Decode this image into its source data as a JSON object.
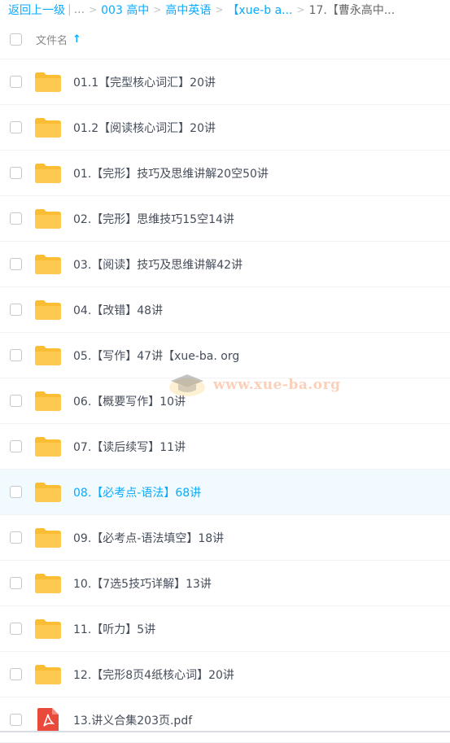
{
  "breadcrumb": {
    "back": "返回上一级",
    "ellipsis": "...",
    "items": [
      "003 高中",
      "高中英语",
      "【xue-b a..."
    ],
    "current": "17.【曹永高中..."
  },
  "header": {
    "column_title": "文件名",
    "sort_icon": "sort-ascending-icon"
  },
  "files": [
    {
      "name": "01.1【完型核心词汇】20讲",
      "type": "folder"
    },
    {
      "name": "01.2【阅读核心词汇】20讲",
      "type": "folder"
    },
    {
      "name": "01.【完形】技巧及思维讲解20空50讲",
      "type": "folder"
    },
    {
      "name": "02.【完形】思维技巧15空14讲",
      "type": "folder"
    },
    {
      "name": "03.【阅读】技巧及思维讲解42讲",
      "type": "folder"
    },
    {
      "name": "04.【改错】48讲",
      "type": "folder"
    },
    {
      "name": "05.【写作】47讲【xue-ba. org",
      "type": "folder"
    },
    {
      "name": "06.【概要写作】10讲",
      "type": "folder"
    },
    {
      "name": "07.【读后续写】11讲",
      "type": "folder"
    },
    {
      "name": "08.【必考点-语法】68讲",
      "type": "folder",
      "selected": true
    },
    {
      "name": "09.【必考点-语法填空】18讲",
      "type": "folder"
    },
    {
      "name": "10.【7选5技巧详解】13讲",
      "type": "folder"
    },
    {
      "name": "11.【听力】5讲",
      "type": "folder"
    },
    {
      "name": "12.【完形8页4纸核心词】20讲",
      "type": "folder"
    },
    {
      "name": "13.讲义合集203页.pdf",
      "type": "pdf"
    }
  ],
  "watermark": {
    "text": "www.xue-ba.org"
  },
  "colors": {
    "accent": "#09aaff",
    "folder": "#fdc951",
    "pdf": "#ea4a3c",
    "selected_bg": "#f1faff"
  }
}
